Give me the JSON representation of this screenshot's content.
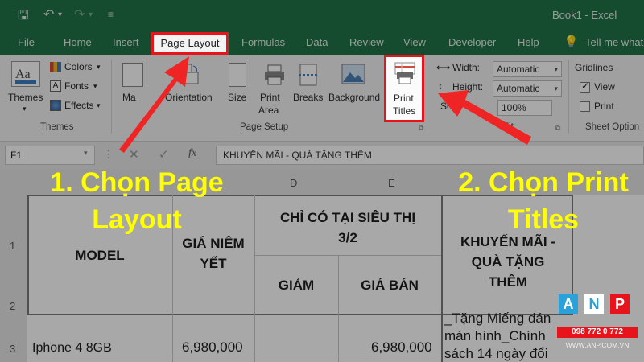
{
  "app": {
    "title": "Book1  -  Excel"
  },
  "tabs": [
    "File",
    "Home",
    "Insert",
    "Page Layout",
    "Formulas",
    "Data",
    "Review",
    "View",
    "Developer",
    "Help"
  ],
  "tell_me": "Tell me what",
  "ribbon": {
    "themes": {
      "label": "Themes",
      "colors": "Colors",
      "fonts": "Fonts",
      "effects": "Effects",
      "group": "Themes"
    },
    "page_setup": {
      "margins": "Ma",
      "orientation": "Orientation",
      "size": "Size",
      "print_area_1": "Print",
      "print_area_2": "Area",
      "breaks": "Breaks",
      "background": "Background",
      "print_titles_1": "Print",
      "print_titles_2": "Titles",
      "group": "Page Setup"
    },
    "scale": {
      "width_label": "Width:",
      "width_value": "Automatic",
      "height_label": "Height:",
      "height_value": "Automatic",
      "scale_label": "Sca",
      "scale_value": "100%",
      "group_tail": "Fit"
    },
    "sheet_options": {
      "gridlines": "Gridlines",
      "view": "View",
      "print": "Print",
      "group": "Sheet Option"
    }
  },
  "formula_bar": {
    "cell_ref": "F1",
    "content": "KHUYẾN MÃI - QUÀ TẶNG THÊM"
  },
  "columns": [
    "D",
    "E"
  ],
  "rows": [
    "1",
    "2",
    "3"
  ],
  "cells": {
    "model": "MODEL",
    "gia_niem_yet_1": "GIÁ NIÊM",
    "gia_niem_yet_2": "YẾT",
    "chi_co_1": "CHỈ CÓ TẠI SIÊU THỊ",
    "chi_co_2": "3/2",
    "giam": "GIẢM",
    "gia_ban": "GIÁ BÁN",
    "km_1": "KHUYẾN MÃI -",
    "km_2": "QUÀ TẶNG",
    "km_3": "THÊM",
    "r3_model": "Iphone 4 8GB",
    "r3_price": "6,980,000",
    "r3_gia_ban": "6,980,000",
    "r3_km_1": "_Tặng Miếng dán",
    "r3_km_2": "màn hình_Chính",
    "r3_km_3": "sách 14 ngày đổi"
  },
  "annotations": {
    "step1_line1": "1. Chọn Page",
    "step1_line2": "Layout",
    "step2_line1": "2. Chọn Print",
    "step2_line2": "Titles"
  },
  "logo": {
    "letters": [
      "A",
      "N",
      "P"
    ],
    "phone": "098 772 0 772",
    "site": "WWW.ANP.COM.VN"
  },
  "colors": {
    "excel_green": "#217346",
    "highlight_red": "#e8141c",
    "annotation_yellow": "#ffff00"
  }
}
